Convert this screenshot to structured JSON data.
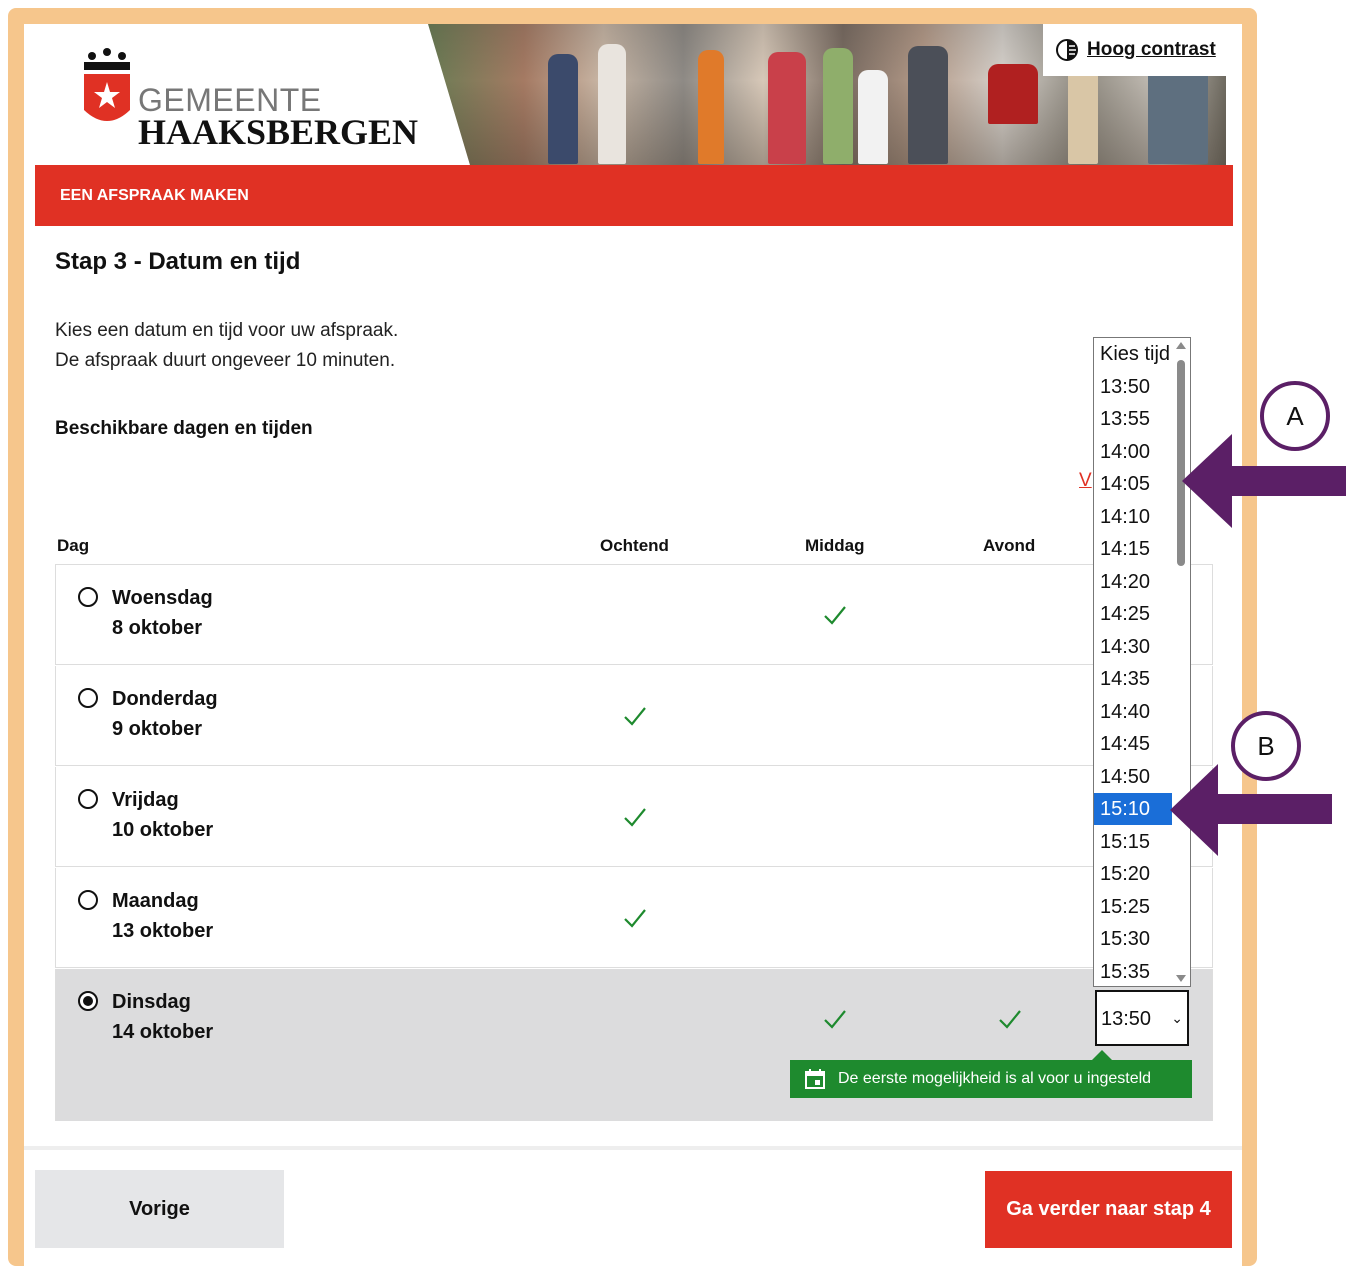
{
  "header": {
    "logo_line1": "GEMEENTE",
    "logo_line2": "HAAKSBERGEN",
    "contrast_label": "Hoog contrast"
  },
  "nav": {
    "title": "EEN AFSPRAAK MAKEN"
  },
  "step": {
    "title": "Stap 3 - Datum en tijd",
    "intro_line1": "Kies een datum en tijd voor uw afspraak.",
    "intro_line2": "De afspraak duurt ongeveer 10 minuten.",
    "subheading": "Beschikbare dagen en tijden",
    "partial_link": "V"
  },
  "table": {
    "columns": [
      "Dag",
      "Ochtend",
      "Middag",
      "Avond"
    ],
    "rows": [
      {
        "day": "Woensdag",
        "date": "8 oktober",
        "ochtend": false,
        "middag": true,
        "avond": false,
        "selected": false
      },
      {
        "day": "Donderdag",
        "date": "9 oktober",
        "ochtend": true,
        "middag": false,
        "avond": false,
        "selected": false
      },
      {
        "day": "Vrijdag",
        "date": "10 oktober",
        "ochtend": true,
        "middag": false,
        "avond": false,
        "selected": false
      },
      {
        "day": "Maandag",
        "date": "13 oktober",
        "ochtend": true,
        "middag": false,
        "avond": false,
        "selected": false
      },
      {
        "day": "Dinsdag",
        "date": "14 oktober",
        "ochtend": false,
        "middag": true,
        "avond": true,
        "selected": true
      }
    ]
  },
  "time_select": {
    "value": "13:50",
    "options": [
      "Kies tijd",
      "13:50",
      "13:55",
      "14:00",
      "14:05",
      "14:10",
      "14:15",
      "14:20",
      "14:25",
      "14:30",
      "14:35",
      "14:40",
      "14:45",
      "14:50",
      "15:10",
      "15:15",
      "15:20",
      "15:25",
      "15:30",
      "15:35"
    ],
    "highlighted": "15:10"
  },
  "tooltip": {
    "text": "De eerste mogelijkheid is al voor u ingesteld"
  },
  "footer": {
    "prev_label": "Vorige",
    "next_label": "Ga verder naar stap 4"
  },
  "annotations": {
    "a": "A",
    "b": "B"
  },
  "colors": {
    "brand_red": "#e03124",
    "frame": "#f6c68c",
    "success_green": "#1e8a2e",
    "highlight_blue": "#1a6ed8",
    "annotation_purple": "#5b1f66"
  }
}
